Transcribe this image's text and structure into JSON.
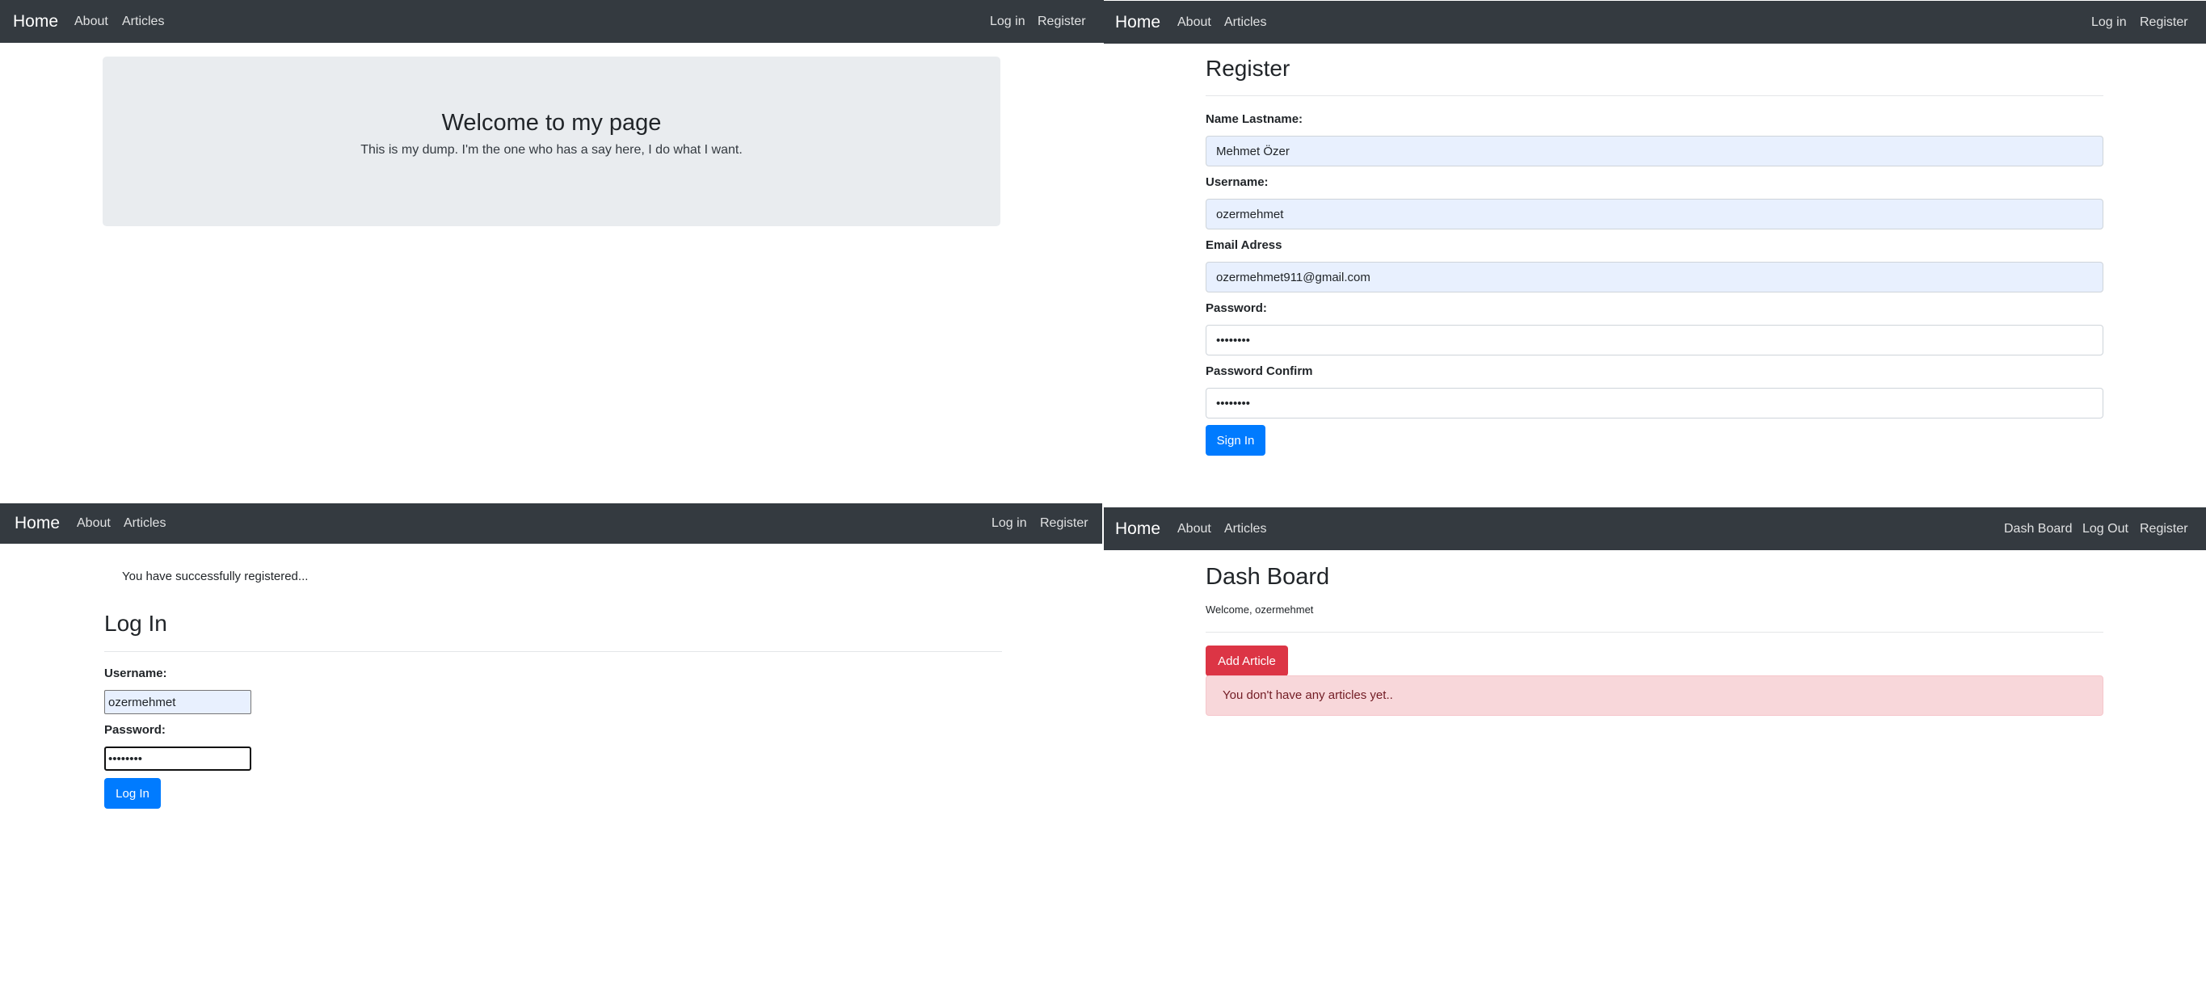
{
  "navbar": {
    "brand": "Home",
    "about": "About",
    "articles": "Articles",
    "login": "Log in",
    "register": "Register",
    "dashboard": "Dash Board",
    "logout": "Log Out"
  },
  "home": {
    "heading": "Welcome to my page",
    "subtext": "This is my dump. I'm the one who has a say here, I do what I want."
  },
  "register": {
    "title": "Register",
    "name_label": "Name Lastname:",
    "name_value": "Mehmet Özer",
    "username_label": "Username:",
    "username_value": "ozermehmet",
    "email_label": "Email Adress",
    "email_value": "ozermehmet911@gmail.com",
    "password_label": "Password:",
    "password_value": "••••••••",
    "confirm_label": "Password Confirm",
    "confirm_value": "••••••••",
    "submit": "Sign In"
  },
  "login": {
    "success_message": "You have successfully registered...",
    "title": "Log In",
    "username_label": "Username:",
    "username_value": "ozermehmet",
    "password_label": "Password:",
    "password_value": "••••••••",
    "submit": "Log In"
  },
  "dashboard": {
    "title": "Dash Board",
    "welcome": "Welcome, ozermehmet",
    "add_button": "Add Article",
    "empty_alert": "You don't have any articles yet.."
  },
  "colors": {
    "navbar": "#343a40",
    "primary": "#007bff",
    "danger": "#dc3545",
    "jumbotron": "#e9ecef",
    "autofill": "#e8f0fe",
    "alert_bg": "#f8d7da"
  }
}
